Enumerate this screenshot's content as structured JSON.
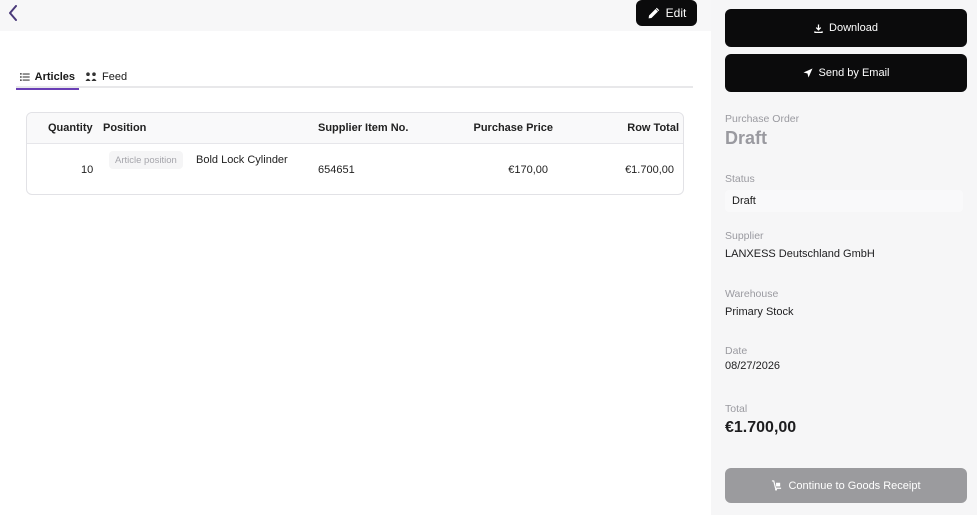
{
  "toolbar": {
    "back_icon": "chevron-left-icon",
    "edit_label": "Edit",
    "edit_icon": "pencil-icon"
  },
  "tabs": [
    {
      "label": "Articles",
      "icon": "list-icon",
      "active": true
    },
    {
      "label": "Feed",
      "icon": "people-icon",
      "active": false
    }
  ],
  "table": {
    "columns": [
      "Quantity",
      "Position",
      "Supplier Item No.",
      "Purchase Price",
      "Row Total"
    ],
    "rows": [
      {
        "quantity": "10",
        "position_chip": "Article position",
        "position": "Bold Lock Cylinder",
        "supplier_item_no": "654651",
        "purchase_price": "€170,00",
        "row_total": "€1.700,00"
      }
    ]
  },
  "sidebar": {
    "download_label": "Download",
    "download_icon": "download-icon",
    "email_label": "Send by Email",
    "email_icon": "send-icon",
    "order_label": "Purchase Order",
    "order_value": "Draft",
    "status_label": "Status",
    "status_value": "Draft",
    "supplier_label": "Supplier",
    "supplier_value": "LANXESS Deutschland GmbH",
    "warehouse_label": "Warehouse",
    "warehouse_value": "Primary Stock",
    "date_label": "Date",
    "date_value": "08/27/2026",
    "total_label": "Total",
    "total_value": "€1.700,00",
    "goods_receipt_label": "Continue to Goods Receipt",
    "goods_receipt_icon": "dolly-icon"
  },
  "colors": {
    "accent": "#6a3fb5",
    "primary_button": "#0b0b0c",
    "disabled_button": "#9b9b9e",
    "sidebar_bg": "#f6f6f7"
  }
}
